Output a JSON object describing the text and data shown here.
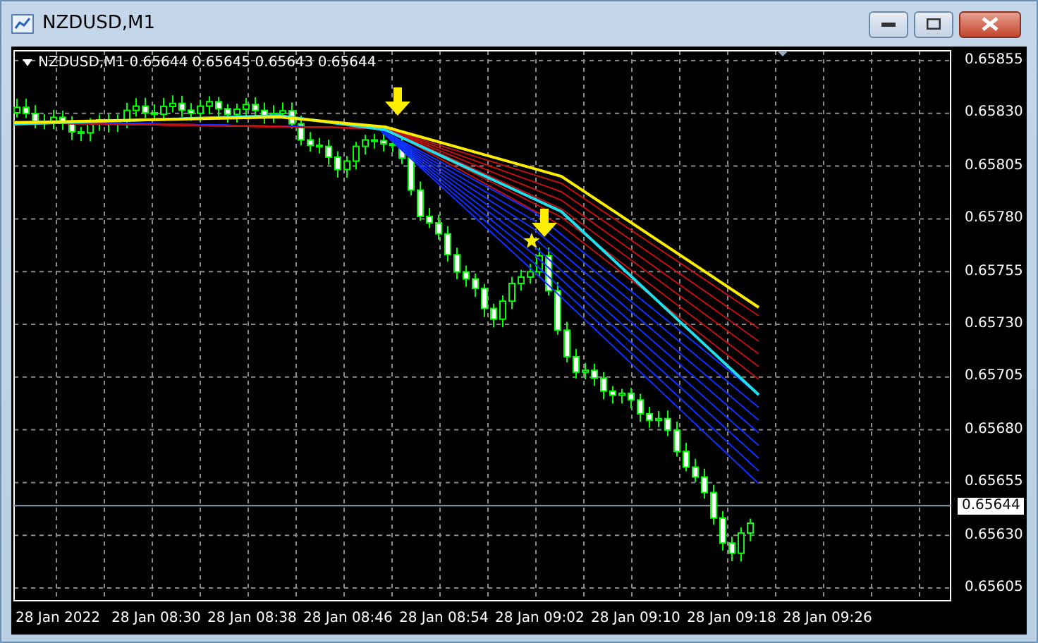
{
  "window": {
    "title": "NZDUSD,M1"
  },
  "legend": "NZDUSD,M1  0.65644 0.65645 0.65643 0.65644",
  "y_axis": [
    "0.65855",
    "0.65830",
    "0.65805",
    "0.65780",
    "0.65755",
    "0.65730",
    "0.65705",
    "0.65680",
    "0.65655",
    "0.65630",
    "0.65605"
  ],
  "current_price": "0.65644",
  "x_axis": [
    "28 Jan 2022",
    "28 Jan 08:30",
    "28 Jan 08:38",
    "28 Jan 08:46",
    "28 Jan 08:54",
    "28 Jan 09:02",
    "28 Jan 09:10",
    "28 Jan 09:18",
    "28 Jan 09:26"
  ]
}
